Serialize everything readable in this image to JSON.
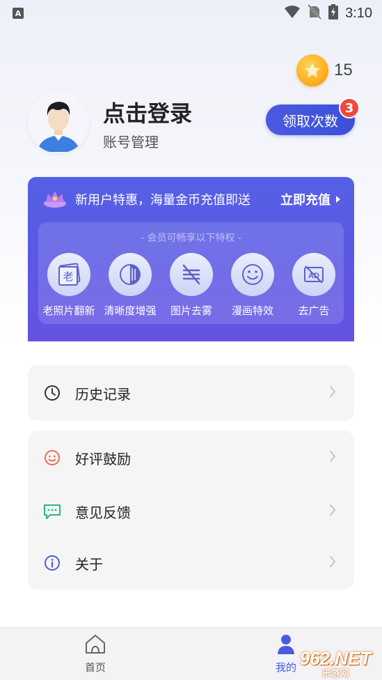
{
  "status_bar": {
    "notif_letter": "A",
    "time": "3:10"
  },
  "coins": {
    "count": "15"
  },
  "profile": {
    "login_title": "点击登录",
    "account_manage": "账号管理",
    "claim_button": "领取次数",
    "claim_badge": "3"
  },
  "vip": {
    "promo_text": "新用户特惠，海量金币充值即送",
    "recharge_label": "立即充值",
    "privileges_title": "- 会员可畅享以下特权 -",
    "privileges": [
      {
        "label": "老照片翻新",
        "icon": "old-photo-icon",
        "glyph": "老"
      },
      {
        "label": "清晰度增强",
        "icon": "contrast-icon"
      },
      {
        "label": "图片去雾",
        "icon": "defog-icon"
      },
      {
        "label": "漫画特效",
        "icon": "smile-face-icon"
      },
      {
        "label": "去广告",
        "icon": "no-ad-icon",
        "glyph": "AD"
      }
    ]
  },
  "menu": {
    "history": "历史记录",
    "rate": "好评鼓励",
    "feedback": "意见反馈",
    "about": "关于"
  },
  "bottom_nav": {
    "home": "首页",
    "mine": "我的"
  },
  "watermark": {
    "main": "962.NET",
    "sub": "乐游网"
  },
  "colors": {
    "accent": "#4a5be0",
    "badge": "#f0493c",
    "coin": "#ffb020",
    "rate_icon": "#f06a55",
    "feedback_icon": "#2bb673",
    "about_icon": "#4a5be0"
  }
}
